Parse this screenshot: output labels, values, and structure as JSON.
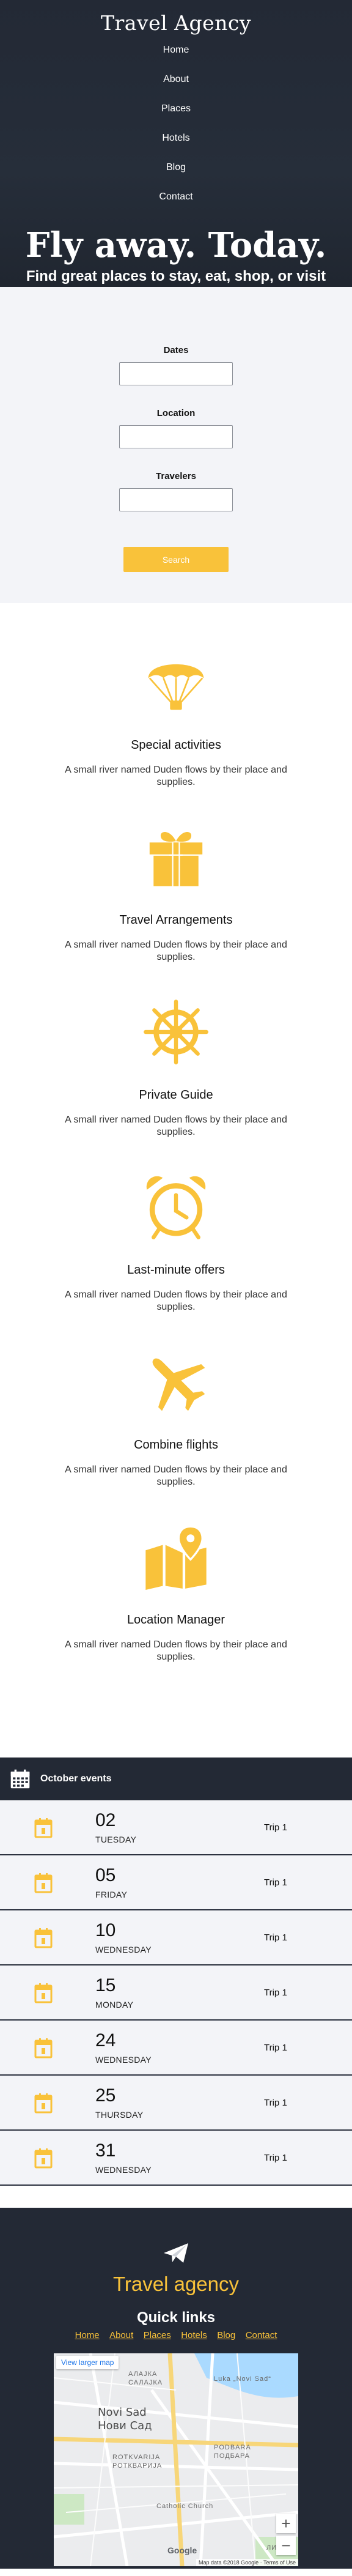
{
  "header": {
    "brand": "Travel Agency",
    "nav": [
      "Home",
      "About",
      "Places",
      "Hotels",
      "Blog",
      "Contact"
    ],
    "hero_title": "Fly away. Today.",
    "hero_subtitle": "Find great places to stay, eat, shop, or visit from local experts"
  },
  "search": {
    "dates_label": "Dates",
    "location_label": "Location",
    "travelers_label": "Travelers",
    "dates_value": "",
    "location_value": "",
    "travelers_value": "",
    "button_label": "Search"
  },
  "features": [
    {
      "title": "Special activities",
      "text": "A small river named Duden flows by their place and supplies.",
      "icon": "parachute-icon"
    },
    {
      "title": "Travel Arrangements",
      "text": "A small river named Duden flows by their place and supplies.",
      "icon": "gift-icon"
    },
    {
      "title": "Private Guide",
      "text": "A small river named Duden flows by their place and supplies.",
      "icon": "ship-wheel-icon"
    },
    {
      "title": "Last-minute offers",
      "text": "A small river named Duden flows by their place and supplies.",
      "icon": "alarm-clock-icon"
    },
    {
      "title": "Combine flights",
      "text": "A small river named Duden flows by their place and supplies.",
      "icon": "airplane-icon"
    },
    {
      "title": "Location Manager",
      "text": "A small river named Duden flows by their place and supplies.",
      "icon": "map-pin-icon"
    }
  ],
  "events": {
    "title": "October events",
    "items": [
      {
        "day": "02",
        "weekday": "TUESDAY",
        "trip": "Trip 1"
      },
      {
        "day": "05",
        "weekday": "FRIDAY",
        "trip": "Trip 1"
      },
      {
        "day": "10",
        "weekday": "WEDNESDAY",
        "trip": "Trip 1"
      },
      {
        "day": "15",
        "weekday": "MONDAY",
        "trip": "Trip 1"
      },
      {
        "day": "24",
        "weekday": "WEDNESDAY",
        "trip": "Trip 1"
      },
      {
        "day": "25",
        "weekday": "THURSDAY",
        "trip": "Trip 1"
      },
      {
        "day": "31",
        "weekday": "WEDNESDAY",
        "trip": "Trip 1"
      }
    ]
  },
  "footer": {
    "brand": "Travel agency",
    "quick_links_title": "Quick links",
    "links": [
      "Home",
      "About",
      "Places",
      "Hotels",
      "Blog",
      "Contact"
    ],
    "map": {
      "view_larger": "View larger map",
      "city_latin": "Novi Sad",
      "city_cyrillic": "Нови Сад",
      "district_1": "АЛАЈКА",
      "district_1b": "САЛАЈКА",
      "district_2": "ROTKVARIJA",
      "district_2b": "РОТКВАРИЈА",
      "district_3": "PODBARA",
      "district_3b": "ПОДБАРА",
      "place_1": "Luka „Novi Sad“",
      "place_2": "Catholic Church",
      "district_4": "ЛИМАН",
      "attribution": "Map data ©2018 Google · Terms of Use",
      "google": "Google",
      "zoom_in": "+",
      "zoom_out": "−"
    }
  },
  "colors": {
    "dark": "#232935",
    "accent": "#f9c23a",
    "light": "#f3f4f8"
  }
}
